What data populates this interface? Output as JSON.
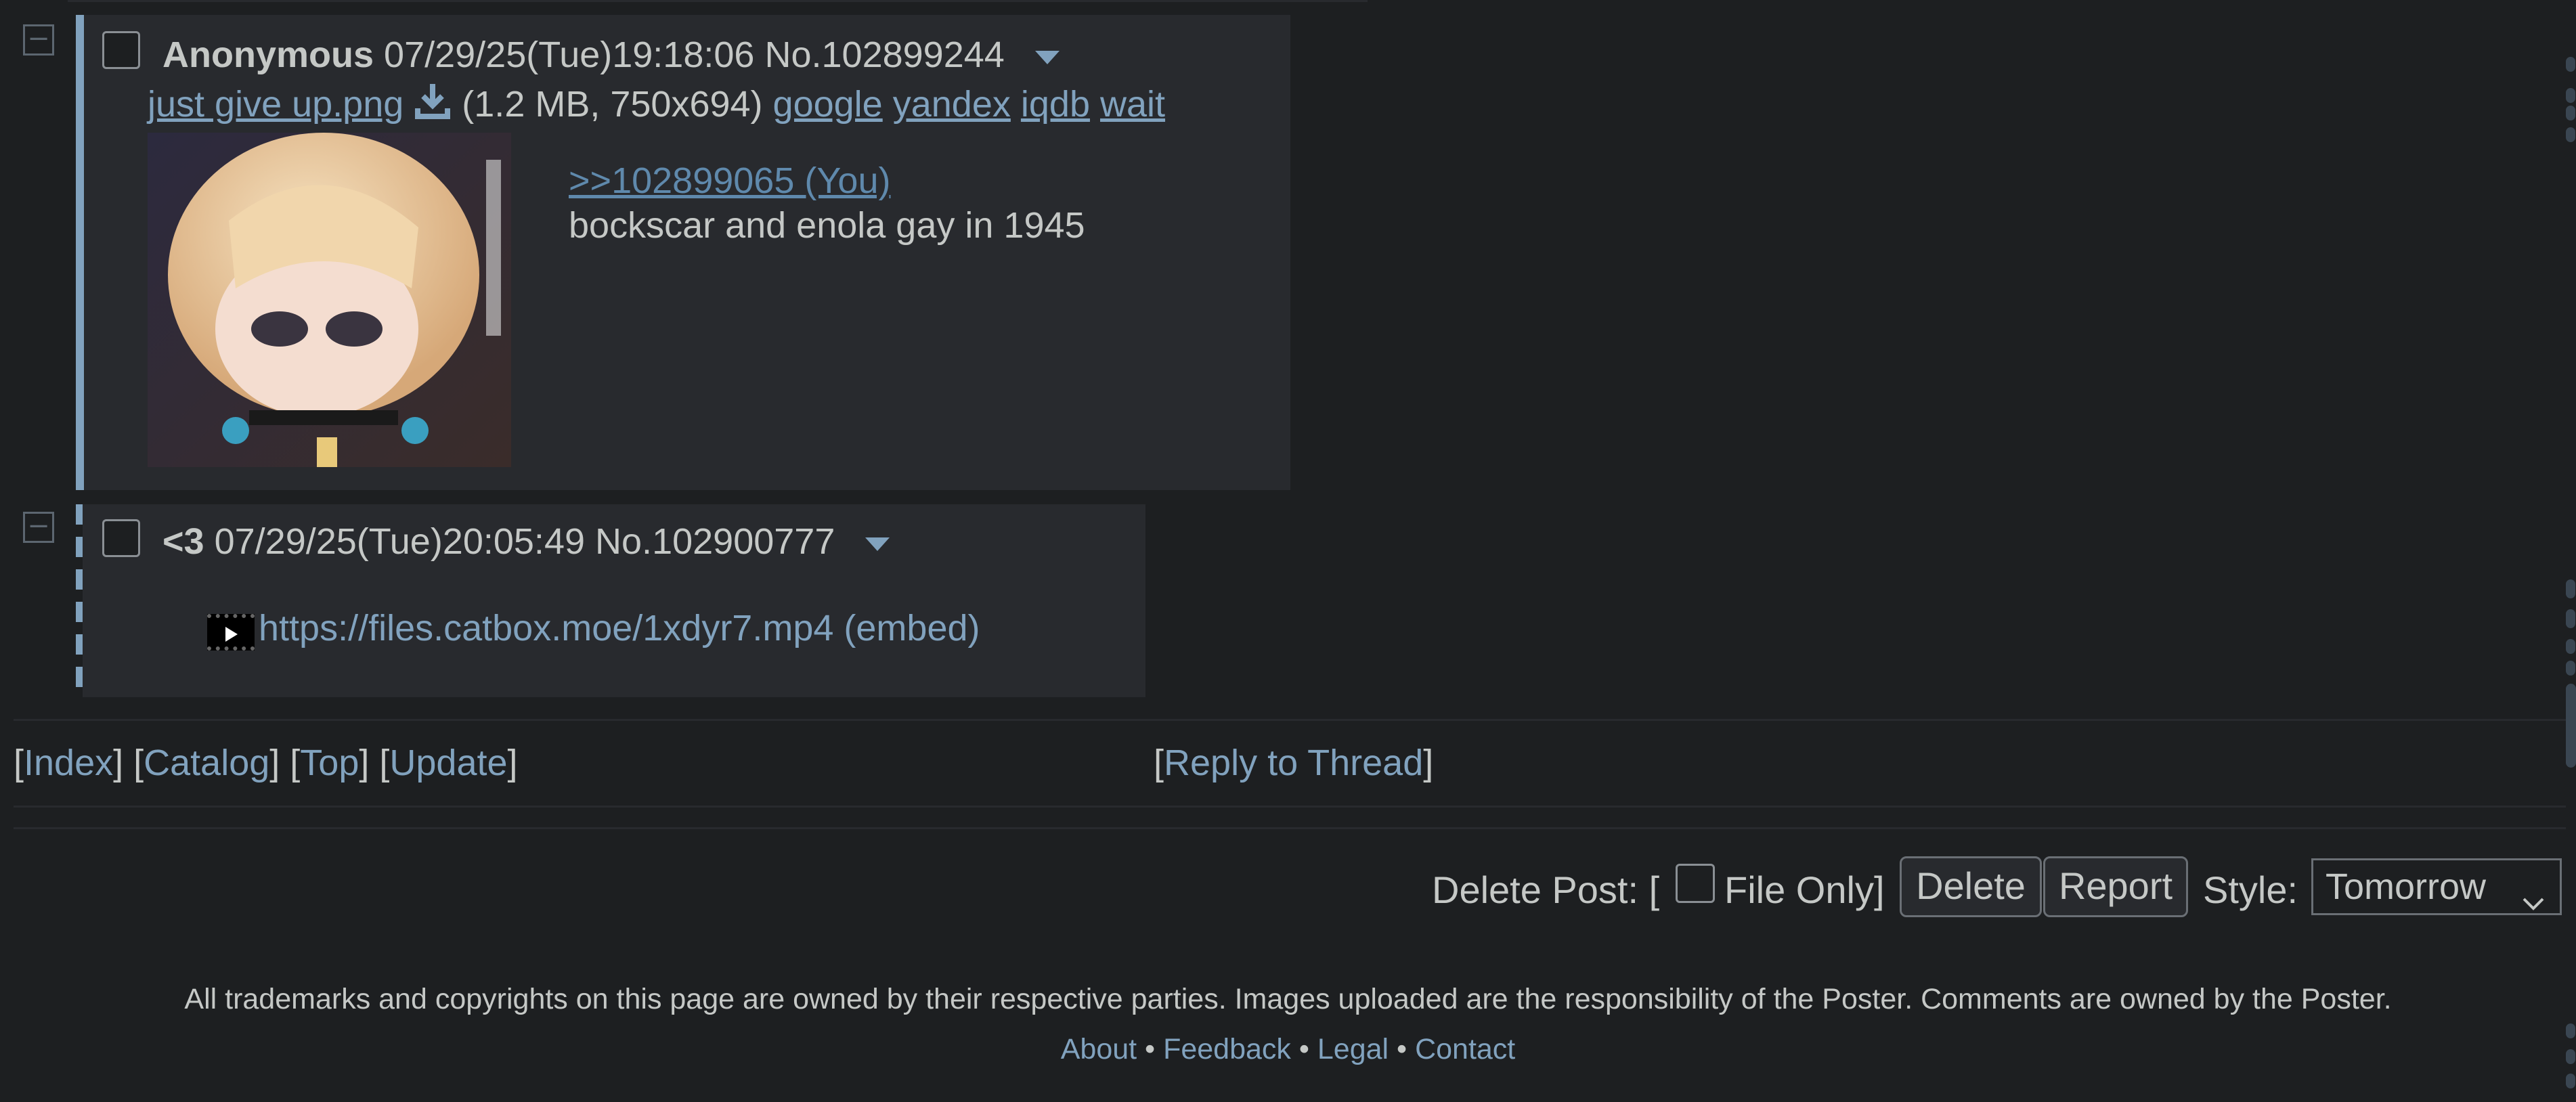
{
  "colors": {
    "background": "#1d1f21",
    "post": "#282a2e",
    "link": "#81a2be",
    "text": "#c5c8c6",
    "quote": "#5f89ac"
  },
  "post1": {
    "name": "Anonymous",
    "datetime": "07/29/25(Tue)19:18:06",
    "number": "No.102899244",
    "filename": "just give up.png",
    "fileinfo": "(1.2 MB, 750x694)",
    "search_links": [
      "google",
      "yandex",
      "iqdb",
      "wait"
    ],
    "quotelink": ">>102899065 (You)",
    "comment": "bockscar and enola gay in 1945"
  },
  "post2": {
    "name": "<3",
    "datetime": "07/29/25(Tue)20:05:49",
    "number": "No.102900777",
    "embed_url": "https://files.catbox.moe/1xdyr7.mp4",
    "embed_label": "(embed)"
  },
  "nav": {
    "index": "Index",
    "catalog": "Catalog",
    "top": "Top",
    "update": "Update",
    "reply": "Reply to Thread"
  },
  "delete_form": {
    "label": "Delete Post: [",
    "file_only": "File Only]",
    "delete_button": "Delete",
    "report_button": "Report",
    "style_label": "Style:",
    "style_value": "Tomorrow"
  },
  "footer": {
    "disclaimer": "All trademarks and copyrights on this page are owned by their respective parties. Images uploaded are the responsibility of the Poster. Comments are owned by the Poster.",
    "about": "About",
    "feedback": "Feedback",
    "legal": "Legal",
    "contact": "Contact",
    "separator": "•"
  }
}
